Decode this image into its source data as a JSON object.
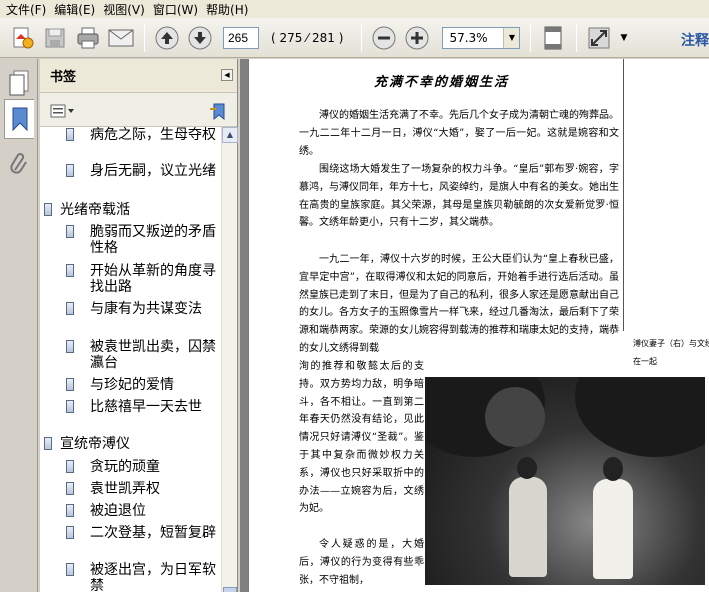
{
  "menu": [
    "文件(F)",
    "编辑(E)",
    "视图(V)",
    "窗口(W)",
    "帮助(H)"
  ],
  "toolbar": {
    "current_page": "265",
    "page_count": "( 275 ⁄ 281 )",
    "zoom": "57.3%",
    "comment_link": "注释"
  },
  "bookmarks": {
    "title": "书签",
    "items": [
      {
        "text": "病危之际，生母夺权"
      },
      {
        "text": "身后无嗣，议立光绪"
      },
      {
        "text": "光绪帝载湉"
      },
      {
        "text": "脆弱而又叛逆的矛盾性格"
      },
      {
        "text": "开始从革新的角度寻找出路"
      },
      {
        "text": "与康有为共谋变法"
      },
      {
        "text": "被袁世凯出卖，囚禁瀛台"
      },
      {
        "text": "与珍妃的爱情"
      },
      {
        "text": "比慈禧早一天去世"
      },
      {
        "text": "宣统帝溥仪"
      },
      {
        "text": "贪玩的顽童"
      },
      {
        "text": "袁世凯弄权"
      },
      {
        "text": "被迫退位"
      },
      {
        "text": "二次登基，短暂复辟"
      },
      {
        "text": "被逐出宫，为日军软禁"
      }
    ]
  },
  "document": {
    "title": "充满不幸的婚姻生活",
    "paragraphs": [
      "溥仪的婚姻生活充满了不幸。先后几个女子成为清朝亡魂的殉葬品。一九二二年十二月一日，溥仪“大婚”，娶了一后一妃。这就是婉容和文绣。",
      "围绕这场大婚发生了一场复杂的权力斗争。“皇后”郭布罗·婉容，字慕鸿，与溥仪同年，年方十七，风姿绰约，是旗人中有名的美女。她出生在高贵的皇族家庭。其父荣源，其母是皇族贝勒毓朗的次女爱新觉罗·恒馨。文绣年龄更小，只有十二岁，其父端恭。",
      "一九二一年，溥仪十六岁的时候，王公大臣们认为“皇上春秋已盛，宜早定中宫”，在取得溥仪和太妃的同意后，开始着手进行选后活动。虽然皇族已走到了末日，但是为了自己的私利，很多人家还是愿意献出自己的女儿。各方女子的玉照像雪片一样飞来，经过几番淘汰，最后剩下了荣源和端恭两家。荣源的女儿婉容得到载涛的推荐和瑞康太妃的支持，端恭的女儿文绣得到载",
      "洵的推荐和敬懿太后的支持。双方势均力敌，明争暗斗，各不相让。一直到第二年春天仍然没有结论，见此情况只好请溥仪“圣裁”。鉴于其中复杂而微妙权力关系，溥仪也只好采取折中的办法——立婉容为后，文绣为妃。",
      "令人疑惑的是，大婚后，溥仪的行为变得有些乖张，不守祖制，"
    ],
    "caption": "溥仪妻子（右）与文绣在一起"
  }
}
